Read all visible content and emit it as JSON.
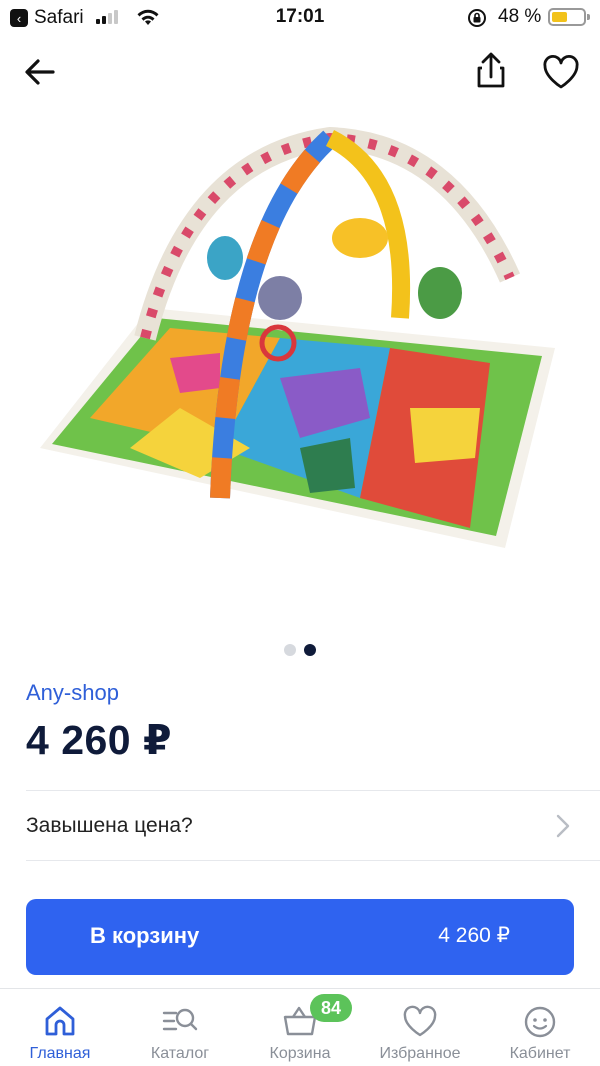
{
  "status_bar": {
    "back_app": "Safari",
    "time": "17:01",
    "battery_percent": "48 %",
    "battery_level": 0.48,
    "battery_color": "#f2c21b"
  },
  "nav": {
    "back_icon": "arrow-left-icon",
    "share_icon": "share-icon",
    "favorite_icon": "heart-icon"
  },
  "gallery": {
    "image_count": 2,
    "active_index": 1
  },
  "product": {
    "shop": "Any-shop",
    "price": "4 260 ₽"
  },
  "report": {
    "label": "Завышена цена?"
  },
  "cart": {
    "button_label": "В корзину",
    "button_price": "4 260 ₽",
    "accent": "#2f63f0"
  },
  "tabbar": {
    "items": [
      {
        "label": "Главная",
        "icon": "home-icon",
        "active": true
      },
      {
        "label": "Каталог",
        "icon": "catalog-search-icon",
        "active": false
      },
      {
        "label": "Корзина",
        "icon": "basket-icon",
        "active": false
      },
      {
        "label": "Избранное",
        "icon": "heart-icon",
        "active": false
      },
      {
        "label": "Кабинет",
        "icon": "smiley-icon",
        "active": false
      }
    ],
    "cart_badge": "84"
  }
}
